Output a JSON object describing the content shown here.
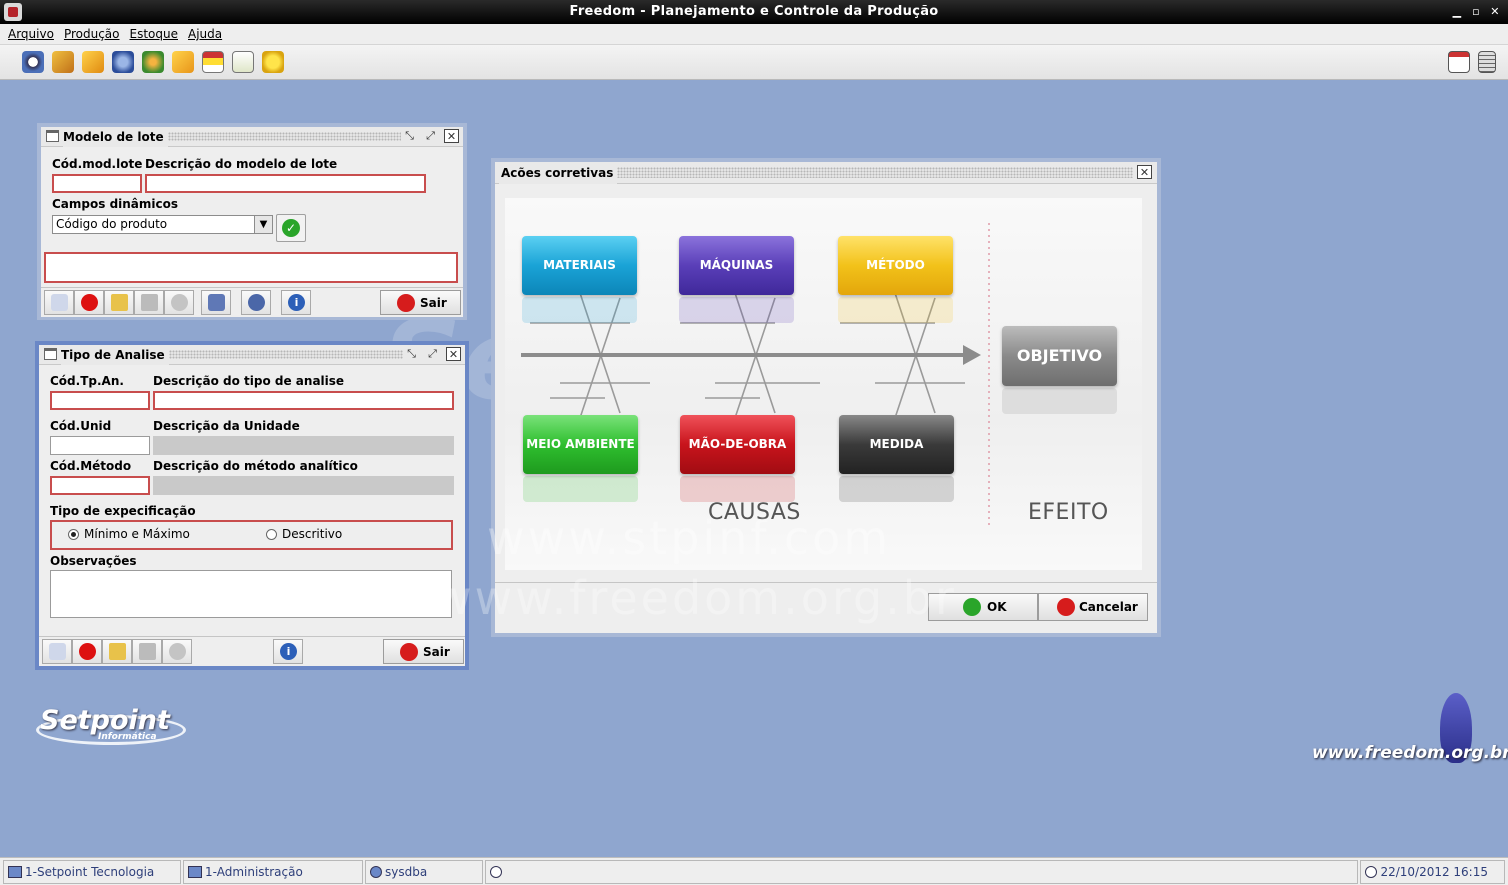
{
  "window": {
    "title": "Freedom - Planejamento e Controle da Produção"
  },
  "menu": [
    "Arquivo",
    "Produção",
    "Estoque",
    "Ajuda"
  ],
  "toolbar_icons": [
    "view-icon",
    "search-box-icon",
    "package-icon",
    "gear-icon",
    "globe-icon",
    "boxes-icon",
    "grid-icon",
    "checklist-icon",
    "star-icon"
  ],
  "toolbar_right_icons": [
    "calendar-clock-icon",
    "calculator-icon"
  ],
  "modelo_lote": {
    "title": "Modelo de lote",
    "cod_label": "Cód.mod.lote",
    "desc_label": "Descrição do modelo de lote",
    "cod_value": "",
    "desc_value": "",
    "campos_label": "Campos dinâmicos",
    "campos_selected": "Código do produto",
    "sair_label": "Sair"
  },
  "tipo_analise": {
    "title": "Tipo de Analise",
    "cod_label": "Cód.Tp.An.",
    "desc_label": "Descrição do tipo de analise",
    "unid_label": "Cód.Unid",
    "unid_desc_label": "Descrição da Unidade",
    "metodo_label": "Cód.Método",
    "metodo_desc_label": "Descrição do método analítico",
    "espec_label": "Tipo de expecificação",
    "radio_min_max": "Mínimo e Máximo",
    "radio_descritivo": "Descritivo",
    "selected_radio": "Mínimo e Máximo",
    "obs_label": "Observações",
    "sair_label": "Sair"
  },
  "acoes": {
    "title": "Acões corretivas",
    "causes_top": [
      "MATERIAIS",
      "MÁQUINAS",
      "MÉTODO"
    ],
    "causes_bottom": [
      "MEIO AMBIENTE",
      "MÃO-DE-OBRA",
      "MEDIDA"
    ],
    "objective": "OBJETIVO",
    "causas_label": "CAUSAS",
    "efeito_label": "EFEITO",
    "ok_label": "OK",
    "cancel_label": "Cancelar"
  },
  "colors": {
    "materiais": "#1aa3d6",
    "maquinas": "#5a3fb8",
    "metodo": "#f2c21a",
    "meio_ambiente": "#2fbf2f",
    "mao_de_obra": "#c8141c",
    "medida": "#3a3a3a",
    "objetivo": "#8a8a8a",
    "desktop": "#8fa6cf"
  },
  "watermark": {
    "line1": "www.stpinf.com",
    "line2": "www.freedom.org.br"
  },
  "branding": {
    "setpoint": "Setpoint",
    "setpoint_sub": "Informática",
    "freedom_url": "www.freedom.org.br"
  },
  "statusbar": {
    "company": "1-Setpoint Tecnologia",
    "module": "1-Administração",
    "user": "sysdba",
    "datetime": "22/10/2012 16:15"
  }
}
